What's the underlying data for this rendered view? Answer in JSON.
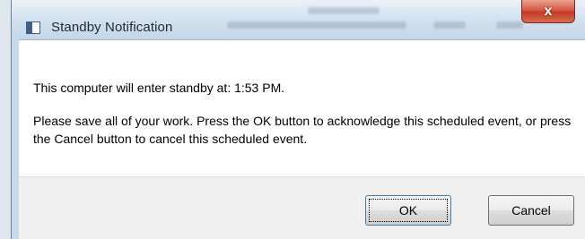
{
  "window": {
    "title": "Standby Notification",
    "close_glyph": "x"
  },
  "icons": {
    "app": "window-app-icon",
    "close": "close-icon"
  },
  "message": {
    "standby": "This computer will enter standby at: 1:53 PM.",
    "instructions": "Please save all of your work. Press the OK button to acknowledge this scheduled event, or press the Cancel button to cancel this scheduled event."
  },
  "buttons": {
    "ok": "OK",
    "cancel": "Cancel"
  },
  "colors": {
    "close_button": "#d6543d",
    "content_bg": "#ffffff",
    "button_bar_bg": "#f0f0f0"
  }
}
